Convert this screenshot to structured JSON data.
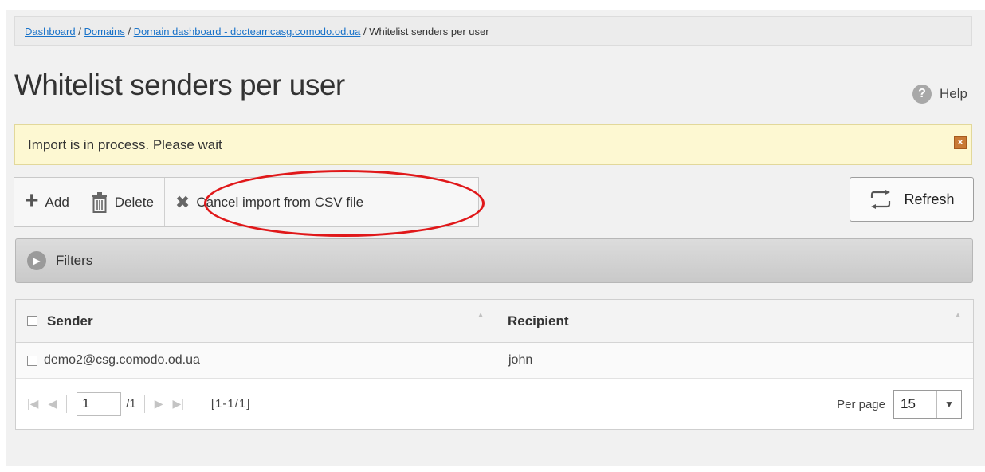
{
  "breadcrumb": {
    "items": [
      "Dashboard",
      "Domains",
      "Domain dashboard - docteamcasg.comodo.od.ua"
    ],
    "separator": "/",
    "current": "Whitelist senders per user"
  },
  "page": {
    "title": "Whitelist senders per user",
    "help_label": "Help",
    "help_icon": "?"
  },
  "notice": {
    "text": "Import is in process. Please wait",
    "close_glyph": "×"
  },
  "toolbar": {
    "add_label": "Add",
    "add_glyph": "+",
    "delete_label": "Delete",
    "cancel_label": "Cancel import from CSV file",
    "cancel_glyph": "✖",
    "refresh_label": "Refresh"
  },
  "filters": {
    "label": "Filters",
    "glyph": "▶"
  },
  "grid": {
    "columns": [
      "Sender",
      "Recipient"
    ],
    "sort_glyph": "▲",
    "rows": [
      {
        "sender": "demo2@csg.comodo.od.ua",
        "recipient": "john"
      }
    ]
  },
  "pager": {
    "first_glyph": "|◀",
    "prev_glyph": "◀",
    "next_glyph": "▶",
    "last_glyph": "▶|",
    "current_page": "1",
    "total_pages": "/1",
    "range": "[1-1/1]",
    "per_page_label": "Per page",
    "per_page_value": "15",
    "dropdown_glyph": "▼"
  },
  "colors": {
    "link": "#1a73c9",
    "notice_bg": "#fdf8d2",
    "highlight_ring": "#e0181a"
  }
}
